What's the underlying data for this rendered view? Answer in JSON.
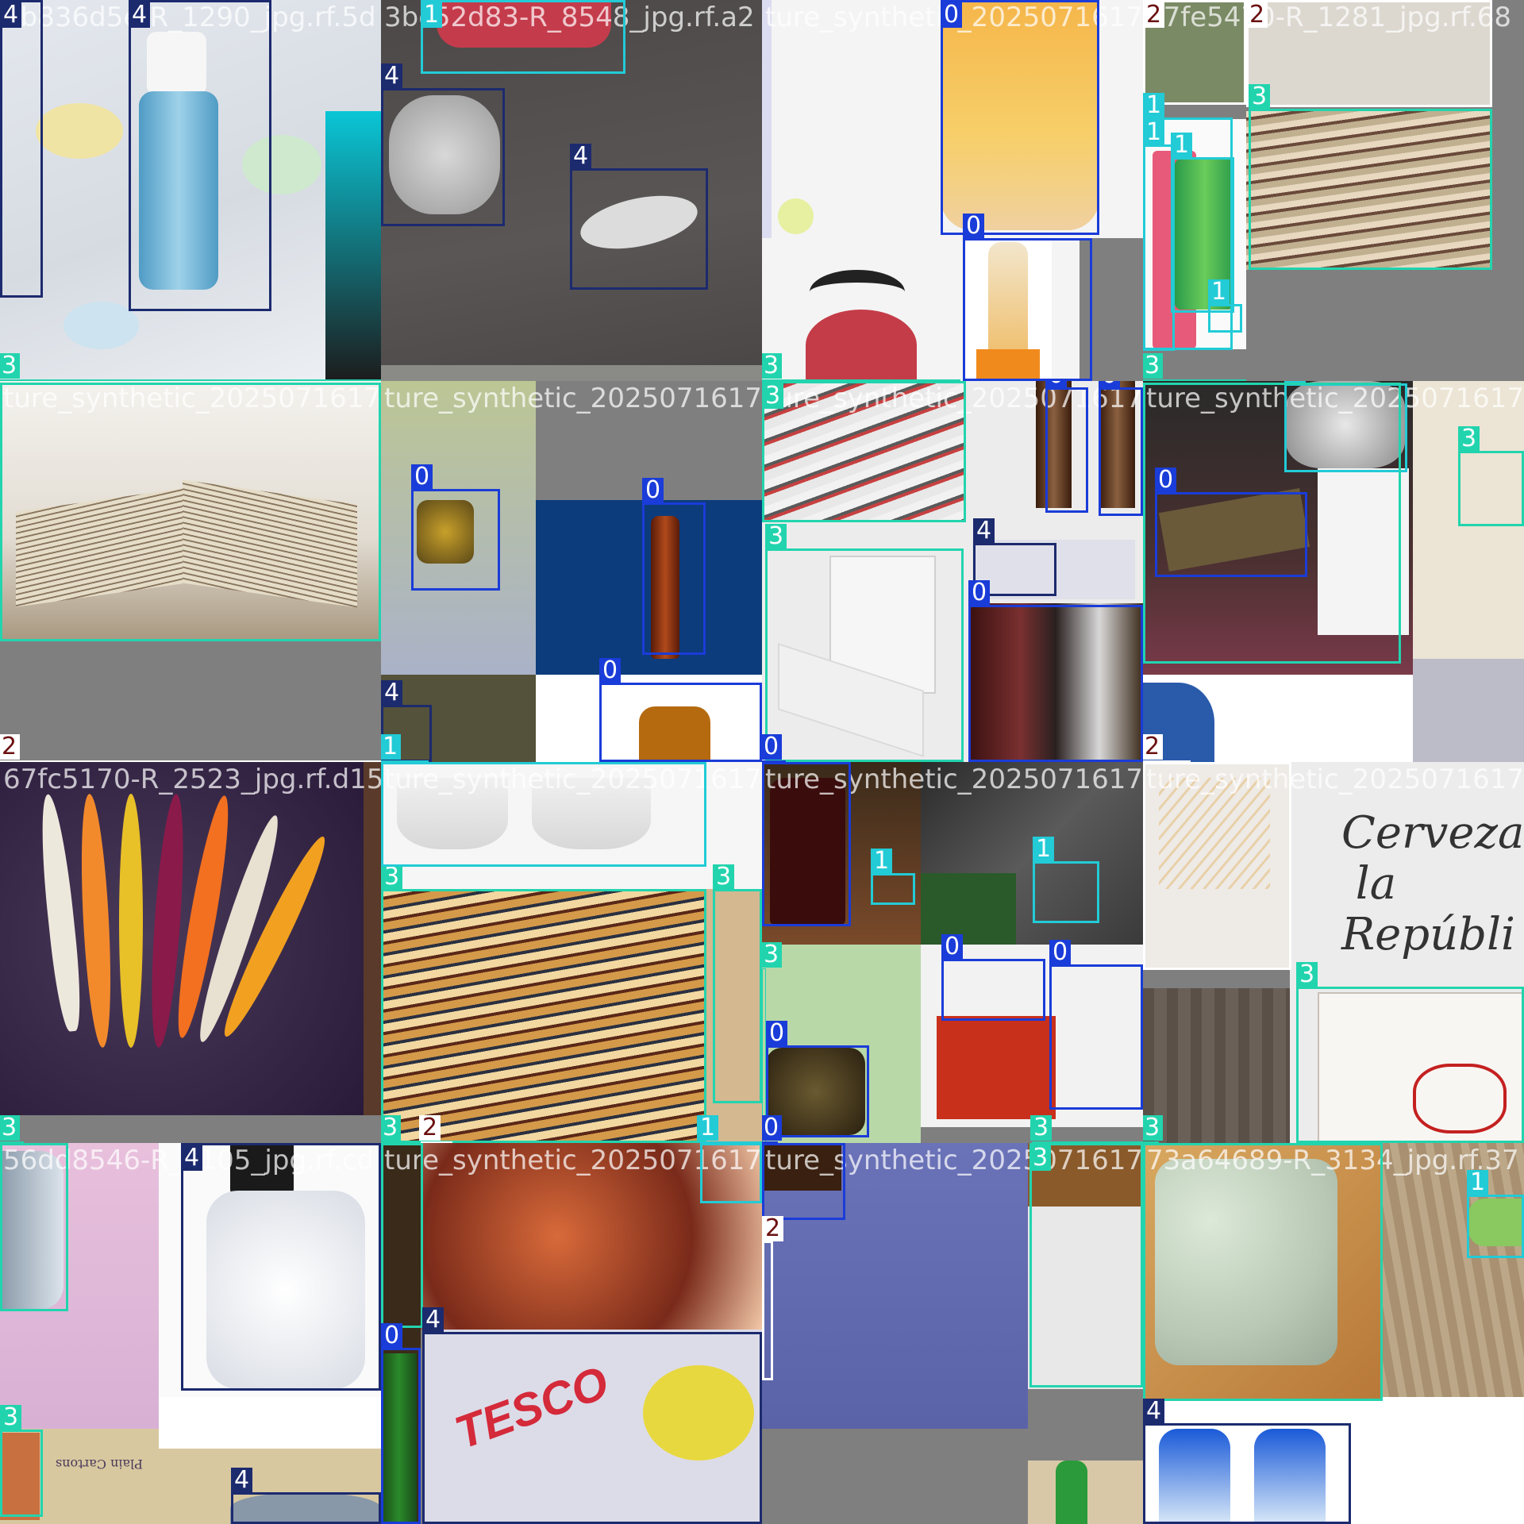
{
  "class_colors": {
    "0": "#1a3cd8",
    "1": "#22cbd6",
    "2": "#ffffff",
    "3": "#22d4ae",
    "4": "#1c2a6e"
  },
  "tiles": [
    {
      "filename": "4b836d5e-R_1290_jpg.rf.5d",
      "labels": [
        "4",
        "4",
        "3"
      ],
      "scene": "foam pump bottle and soaps"
    },
    {
      "filename": "3bc52d83-R_8548_jpg.rf.a2",
      "labels": [
        "1",
        "4",
        "4"
      ],
      "scene": "crumpled waste on dark floor"
    },
    {
      "filename": "ture_synthetic_20250716172",
      "labels": [
        "0",
        "0",
        "3"
      ],
      "scene": "juice jar and glass bottle"
    },
    {
      "filename": "27fe5470-R_1281_jpg.rf.68",
      "labels": [
        "2",
        "2",
        "3",
        "1",
        "1",
        "1",
        "1",
        "3"
      ],
      "scene": "cans and stacked paper"
    },
    {
      "filename": "ture_synthetic_20250716172",
      "labels": [
        "2"
      ],
      "scene": "open old book"
    },
    {
      "filename": "ture_synthetic_20250716172",
      "labels": [
        "0",
        "0",
        "4",
        "0",
        "1"
      ],
      "scene": "jar and beer bottles"
    },
    {
      "filename": "ture_synthetic_20250716172",
      "labels": [
        "3",
        "0",
        "0",
        "3",
        "4",
        "0",
        "0"
      ],
      "scene": "newspapers, box and beer bottles"
    },
    {
      "filename": "ture_synthetic_20250716172",
      "labels": [
        "1",
        "0",
        "3",
        "2"
      ],
      "scene": "foil, cardboard and person"
    },
    {
      "filename": "67fc5170-R_2523_jpg.rf.d15",
      "labels": [
        "3"
      ],
      "scene": "colourful carrots"
    },
    {
      "filename": "ture_synthetic_20250716172",
      "labels": [
        "3",
        "3",
        "3",
        "2",
        "1"
      ],
      "scene": "books and tins"
    },
    {
      "filename": "ture_synthetic_20250716172",
      "labels": [
        "1",
        "1",
        "3",
        "0",
        "0",
        "0",
        "0",
        "3"
      ],
      "scene": "bottles and cans"
    },
    {
      "filename": "ture_synthetic_20250716172",
      "labels": [
        "3",
        "3"
      ],
      "scene": "Cervezas la Republica box"
    },
    {
      "filename": "56dd8546-R_1105_jpg.rf.cd",
      "labels": [
        "4",
        "3",
        "4"
      ],
      "scene": "plastic bottles and cartons"
    },
    {
      "filename": "ture_synthetic_20250716172",
      "labels": [
        "1",
        "0",
        "4"
      ],
      "scene": "food and Tesco bag"
    },
    {
      "filename": "ture_synthetic_20250716172",
      "labels": [
        "2",
        "3"
      ],
      "scene": "blue gradient and cardboard"
    },
    {
      "filename": "73a64689-R_3134_jpg.rf.37",
      "labels": [
        "1",
        "4"
      ],
      "scene": "egg carton and water bottles"
    }
  ]
}
